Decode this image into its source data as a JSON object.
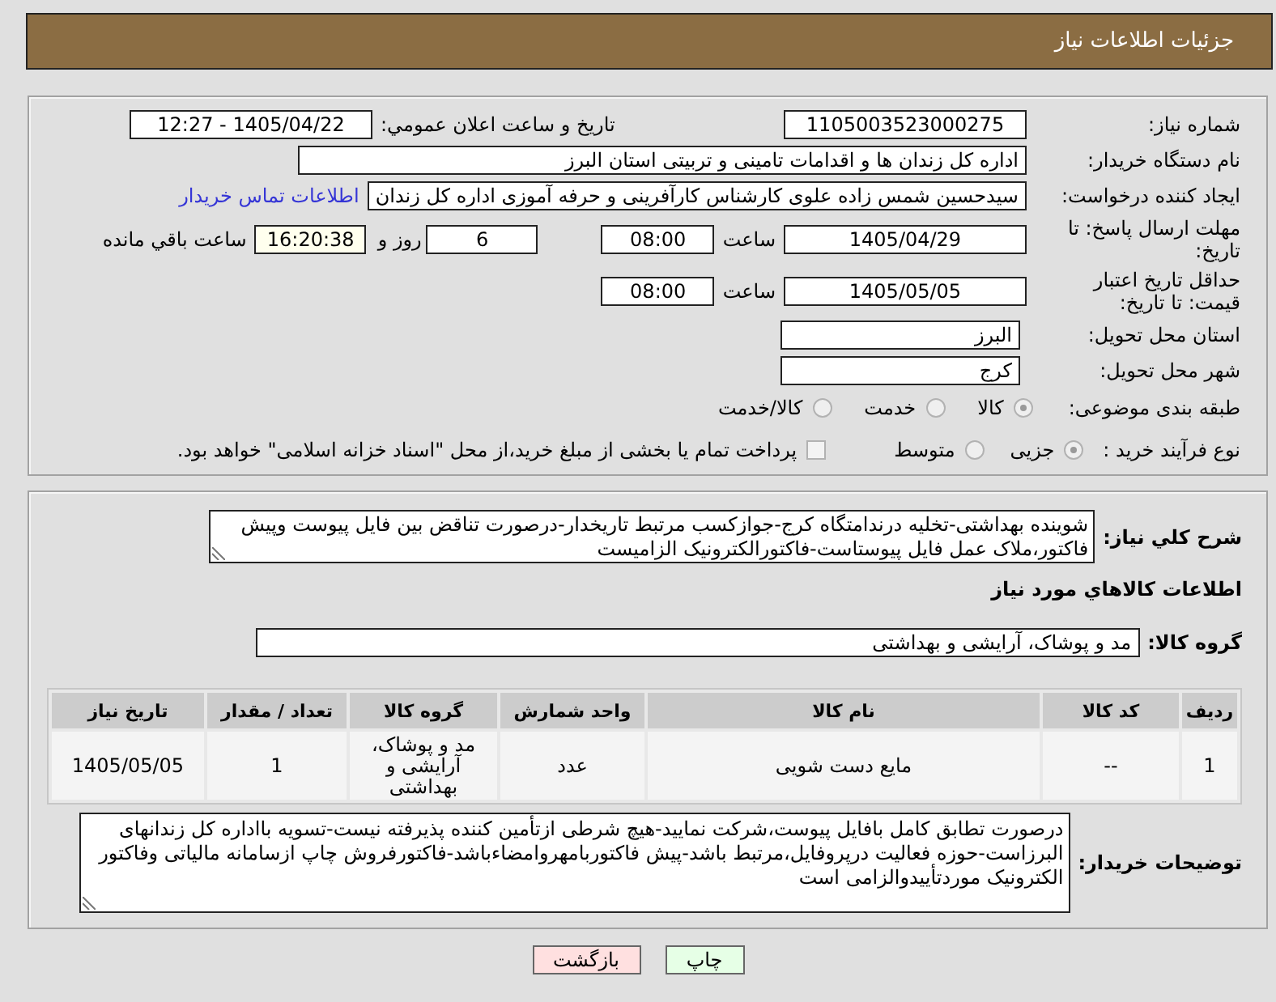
{
  "header": {
    "title": "جزئیات اطلاعات نیاز"
  },
  "need_number": {
    "label": "شماره نیاز:",
    "value": "1105003523000275"
  },
  "announcement": {
    "label": "تاریخ و ساعت اعلان عمومي:",
    "value": "1405/04/22 - 12:27"
  },
  "buyer_org": {
    "label": "نام دستگاه خریدار:",
    "value": "اداره کل زندان ها و اقدامات تامینی و تربیتی استان البرز"
  },
  "requester": {
    "label": "ایجاد کننده درخواست:",
    "value": "سیدحسین شمس زاده علوی کارشناس کارآفرینی و حرفه آموزی اداره کل زندان",
    "contact_link": "اطلاعات تماس خریدار"
  },
  "response_deadline": {
    "label": "مهلت ارسال پاسخ: تا تاریخ:",
    "date": "1405/04/29",
    "time_label": "ساعت",
    "time": "08:00",
    "days": "6",
    "days_label": "روز و",
    "remaining": "16:20:38",
    "remaining_label": "ساعت باقي مانده"
  },
  "price_validity": {
    "label": "حداقل تاریخ اعتبار قیمت: تا تاریخ:",
    "date": "1405/05/05",
    "time_label": "ساعت",
    "time": "08:00"
  },
  "delivery_province": {
    "label": "استان محل تحویل:",
    "value": "البرز"
  },
  "delivery_city": {
    "label": "شهر محل تحویل:",
    "value": "کرج"
  },
  "category": {
    "label": "طبقه بندی موضوعی:",
    "options": [
      {
        "label": "کالا",
        "selected": true
      },
      {
        "label": "خدمت",
        "selected": false
      },
      {
        "label": "کالا/خدمت",
        "selected": false
      }
    ]
  },
  "purchase_type": {
    "label": "نوع فرآیند خرید :",
    "options": [
      {
        "label": "جزیی",
        "selected": true
      },
      {
        "label": "متوسط",
        "selected": false
      }
    ],
    "treasury_payment": {
      "label": "پرداخت تمام یا بخشی از مبلغ خرید،از محل \"اسناد خزانه اسلامی\" خواهد بود.",
      "checked": false
    }
  },
  "description": {
    "label": "شرح کلي نیاز:",
    "value": "شوینده بهداشتی-تخلیه درندامتگاه کرج-جوازکسب مرتبط تاریخدار-درصورت تناقض بین فایل پیوست وپیش فاکتور،ملاک عمل فایل پیوستاست-فاکتورالکترونیک الزامیست"
  },
  "goods": {
    "title": "اطلاعات کالاهاي مورد نیاز",
    "group_label": "گروه کالا:",
    "group_value": "مد و پوشاک، آرایشی و بهداشتی"
  },
  "table": {
    "columns": [
      "ردیف",
      "کد کالا",
      "نام کالا",
      "واحد شمارش",
      "گروه کالا",
      "تعداد / مقدار",
      "تاریخ نیاز"
    ],
    "rows": [
      [
        "1",
        "--",
        "مایع دست شویی",
        "عدد",
        "مد و پوشاک، آرایشی و بهداشتی",
        "1",
        "1405/05/05"
      ]
    ]
  },
  "buyer_notes": {
    "label": "توضیحات خریدار:",
    "value": "درصورت تطابق کامل بافایل پیوست،شرکت نمایید-هیچ شرطی ازتأمین کننده پذیرفته نیست-تسویه بااداره کل زندانهای البرزاست-حوزه فعالیت درپروفایل،مرتبط باشد-پیش فاکتوربامهروامضاءباشد-فاکتورفروش چاپ ازسامانه مالیاتی وفاکتور الکترونیک موردتأییدوالزامی است"
  },
  "buttons": [
    {
      "label": "چاپ",
      "kind": "print"
    },
    {
      "label": "بازگشت",
      "kind": "back"
    }
  ]
}
